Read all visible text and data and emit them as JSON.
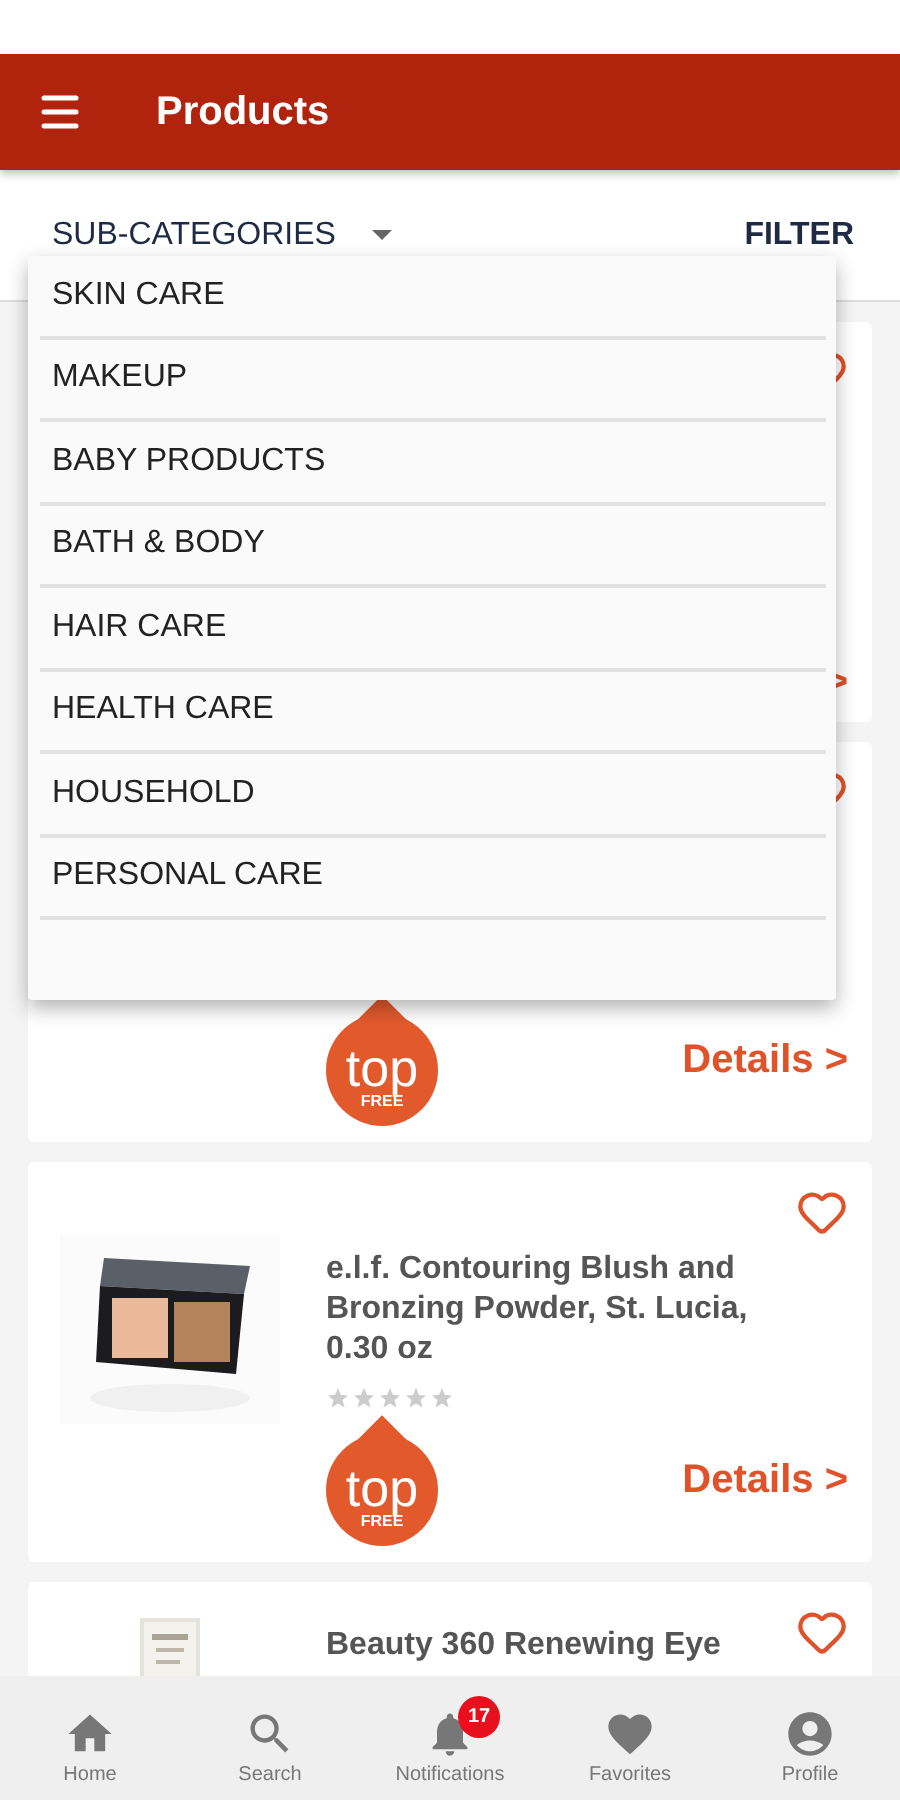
{
  "app_bar": {
    "title": "Products"
  },
  "toolbar": {
    "dropdown_label": "SUB-CATEGORIES",
    "filter": "FILTER"
  },
  "dropdown": {
    "items": [
      {
        "label": "SKIN CARE"
      },
      {
        "label": "MAKEUP"
      },
      {
        "label": "BABY PRODUCTS"
      },
      {
        "label": "BATH & BODY"
      },
      {
        "label": "HAIR CARE"
      },
      {
        "label": "HEALTH CARE"
      },
      {
        "label": "HOUSEHOLD"
      },
      {
        "label": "PERSONAL CARE"
      }
    ]
  },
  "products": [
    {
      "favorite": false,
      "details": ">"
    },
    {
      "favorite": false,
      "badge": {
        "top": "top",
        "bottom": "FREE"
      },
      "details": "Details >"
    },
    {
      "favorite": false,
      "title": "e.l.f. Contouring Blush and Bronzing Powder, St. Lucia, 0.30 oz",
      "stars": 0,
      "badge": {
        "top": "top",
        "bottom": "FREE"
      },
      "details": "Details >"
    },
    {
      "favorite": false,
      "title": "Beauty 360 Renewing Eye"
    }
  ],
  "tab_bar": {
    "items": [
      {
        "kind": "home",
        "label": "Home"
      },
      {
        "kind": "search",
        "label": "Search"
      },
      {
        "kind": "notifications",
        "label": "Notifications",
        "badge": "17"
      },
      {
        "kind": "favorites",
        "label": "Favorites"
      },
      {
        "kind": "profile",
        "label": "Profile"
      }
    ]
  }
}
